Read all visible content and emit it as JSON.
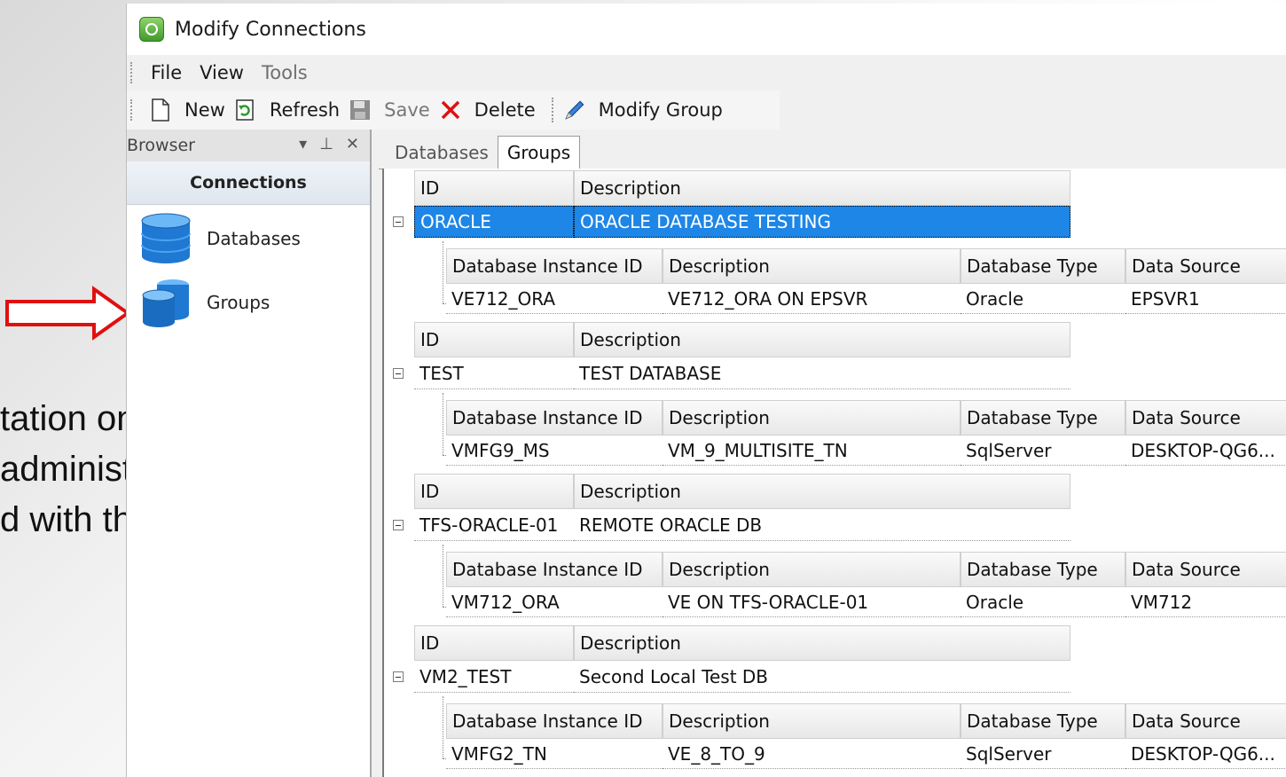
{
  "slide": {
    "line1": "tation on",
    "line2": "administration",
    "line3": "d with the software"
  },
  "window": {
    "title": "Modify Connections"
  },
  "menu": {
    "file": "File",
    "view": "View",
    "tools": "Tools"
  },
  "toolbar": {
    "new": "New",
    "refresh": "Refresh",
    "save": "Save",
    "delete": "Delete",
    "modify_group": "Modify Group"
  },
  "browser": {
    "title": "Browser",
    "section": "Connections",
    "items": [
      {
        "label": "Databases"
      },
      {
        "label": "Groups"
      }
    ]
  },
  "tabs": [
    {
      "label": "Databases"
    },
    {
      "label": "Groups"
    }
  ],
  "group_headers": {
    "id": "ID",
    "description": "Description"
  },
  "child_headers": {
    "instance_id": "Database Instance ID",
    "description": "Description",
    "type": "Database Type",
    "source": "Data Source"
  },
  "groups": [
    {
      "id": "ORACLE",
      "description": "ORACLE DATABASE TESTING",
      "child": {
        "instance_id": "VE712_ORA",
        "description": "VE712_ORA ON EPSVR",
        "type": "Oracle",
        "source": "EPSVR1"
      }
    },
    {
      "id": "TEST",
      "description": "TEST DATABASE",
      "child": {
        "instance_id": "VMFG9_MS",
        "description": "VM_9_MULTISITE_TN",
        "type": "SqlServer",
        "source": "DESKTOP-QG6..."
      }
    },
    {
      "id": "TFS-ORACLE-01",
      "description": "REMOTE ORACLE DB",
      "child": {
        "instance_id": "VM712_ORA",
        "description": "VE ON TFS-ORACLE-01",
        "type": "Oracle",
        "source": "VM712"
      }
    },
    {
      "id": "VM2_TEST",
      "description": "Second Local Test DB",
      "child": {
        "instance_id": "VMFG2_TN",
        "description": "VE_8_TO_9",
        "type": "SqlServer",
        "source": "DESKTOP-QG6..."
      }
    }
  ],
  "colors": {
    "selection": "#1e86e6",
    "arrow": "#e01010",
    "db_icon": "#1f78d1"
  }
}
